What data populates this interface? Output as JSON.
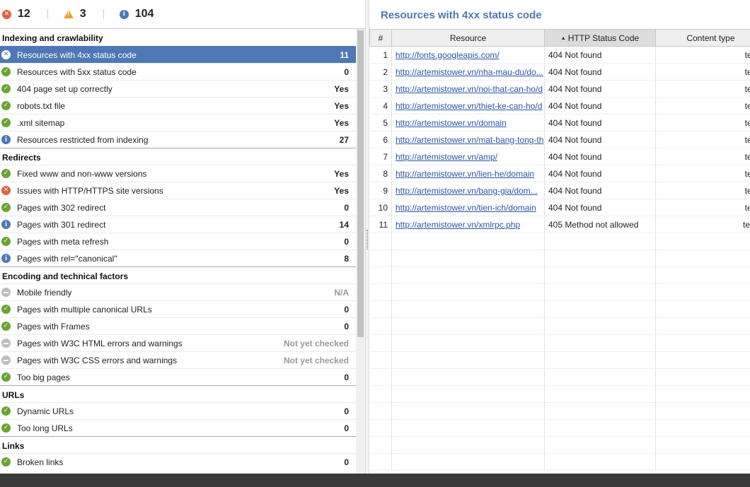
{
  "summary": {
    "errors": "12",
    "warnings": "3",
    "info": "104"
  },
  "sections": [
    {
      "title": "Indexing and crawlability",
      "items": [
        {
          "status": "error",
          "label": "Resources with 4xx status code",
          "value": "11",
          "selected": true
        },
        {
          "status": "ok",
          "label": "Resources with 5xx status code",
          "value": "0"
        },
        {
          "status": "ok",
          "label": "404 page set up correctly",
          "value": "Yes"
        },
        {
          "status": "ok",
          "label": "robots.txt file",
          "value": "Yes"
        },
        {
          "status": "ok",
          "label": ".xml sitemap",
          "value": "Yes"
        },
        {
          "status": "info",
          "label": "Resources restricted from indexing",
          "value": "27"
        }
      ]
    },
    {
      "title": "Redirects",
      "items": [
        {
          "status": "ok",
          "label": "Fixed www and non-www versions",
          "value": "Yes"
        },
        {
          "status": "error",
          "label": "Issues with HTTP/HTTPS site versions",
          "value": "Yes"
        },
        {
          "status": "ok",
          "label": "Pages with 302 redirect",
          "value": "0"
        },
        {
          "status": "info",
          "label": "Pages with 301 redirect",
          "value": "14"
        },
        {
          "status": "ok",
          "label": "Pages with meta refresh",
          "value": "0"
        },
        {
          "status": "info",
          "label": "Pages with rel=\"canonical\"",
          "value": "8"
        }
      ]
    },
    {
      "title": "Encoding and technical factors",
      "items": [
        {
          "status": "na",
          "label": "Mobile friendly",
          "value": "N/A",
          "muted": true
        },
        {
          "status": "ok",
          "label": "Pages with multiple canonical URLs",
          "value": "0"
        },
        {
          "status": "ok",
          "label": "Pages with Frames",
          "value": "0"
        },
        {
          "status": "na",
          "label": "Pages with W3C HTML errors and warnings",
          "value": "Not yet checked",
          "muted": true
        },
        {
          "status": "na",
          "label": "Pages with W3C CSS errors and warnings",
          "value": "Not yet checked",
          "muted": true
        },
        {
          "status": "ok",
          "label": "Too big pages",
          "value": "0"
        }
      ]
    },
    {
      "title": "URLs",
      "items": [
        {
          "status": "ok",
          "label": "Dynamic URLs",
          "value": "0"
        },
        {
          "status": "ok",
          "label": "Too long URLs",
          "value": "0"
        }
      ]
    },
    {
      "title": "Links",
      "items": [
        {
          "status": "ok",
          "label": "Broken links",
          "value": "0"
        }
      ]
    }
  ],
  "detail": {
    "title": "Resources with 4xx status code",
    "columns": [
      "#",
      "Resource",
      "HTTP Status Code",
      "Content type"
    ],
    "sorted_column": "HTTP Status Code",
    "rows": [
      {
        "n": "1",
        "resource": "http://fonts.googleapis.com/",
        "status": "404 Not found",
        "type": "text/h"
      },
      {
        "n": "2",
        "resource": "http://artemistower.vn/nha-mau-du/do...",
        "status": "404 Not found",
        "type": "text/h"
      },
      {
        "n": "3",
        "resource": "http://artemistower.vn/noi-that-can-ho/d",
        "status": "404 Not found",
        "type": "text/h"
      },
      {
        "n": "4",
        "resource": "http://artemistower.vn/thiet-ke-can-ho/d",
        "status": "404 Not found",
        "type": "text/h"
      },
      {
        "n": "5",
        "resource": "http://artemistower.vn/domain",
        "status": "404 Not found",
        "type": "text/h"
      },
      {
        "n": "6",
        "resource": "http://artemistower.vn/mat-bang-tong-th",
        "status": "404 Not found",
        "type": "text/h"
      },
      {
        "n": "7",
        "resource": "http://artemistower.vn/amp/",
        "status": "404 Not found",
        "type": "text/h"
      },
      {
        "n": "8",
        "resource": "http://artemistower.vn/lien-he/domain",
        "status": "404 Not found",
        "type": "text/h"
      },
      {
        "n": "9",
        "resource": "http://artemistower.vn/bang-gia/dom...",
        "status": "404 Not found",
        "type": "text/h"
      },
      {
        "n": "10",
        "resource": "http://artemistower.vn/tien-ich/domain",
        "status": "404 Not found",
        "type": "text/h"
      },
      {
        "n": "11",
        "resource": "http://artemistower.vn/xmlrpc.php",
        "status": "405 Method not allowed",
        "type": "text/pl"
      }
    ]
  },
  "colors": {
    "selected": "#4d78b5",
    "ok": "#6aa531",
    "error": "#e2603f",
    "warning": "#f0a030",
    "info": "#4d78b5",
    "na": "#bdbdbd",
    "title": "#4d78b5",
    "link": "#2b56a8"
  }
}
